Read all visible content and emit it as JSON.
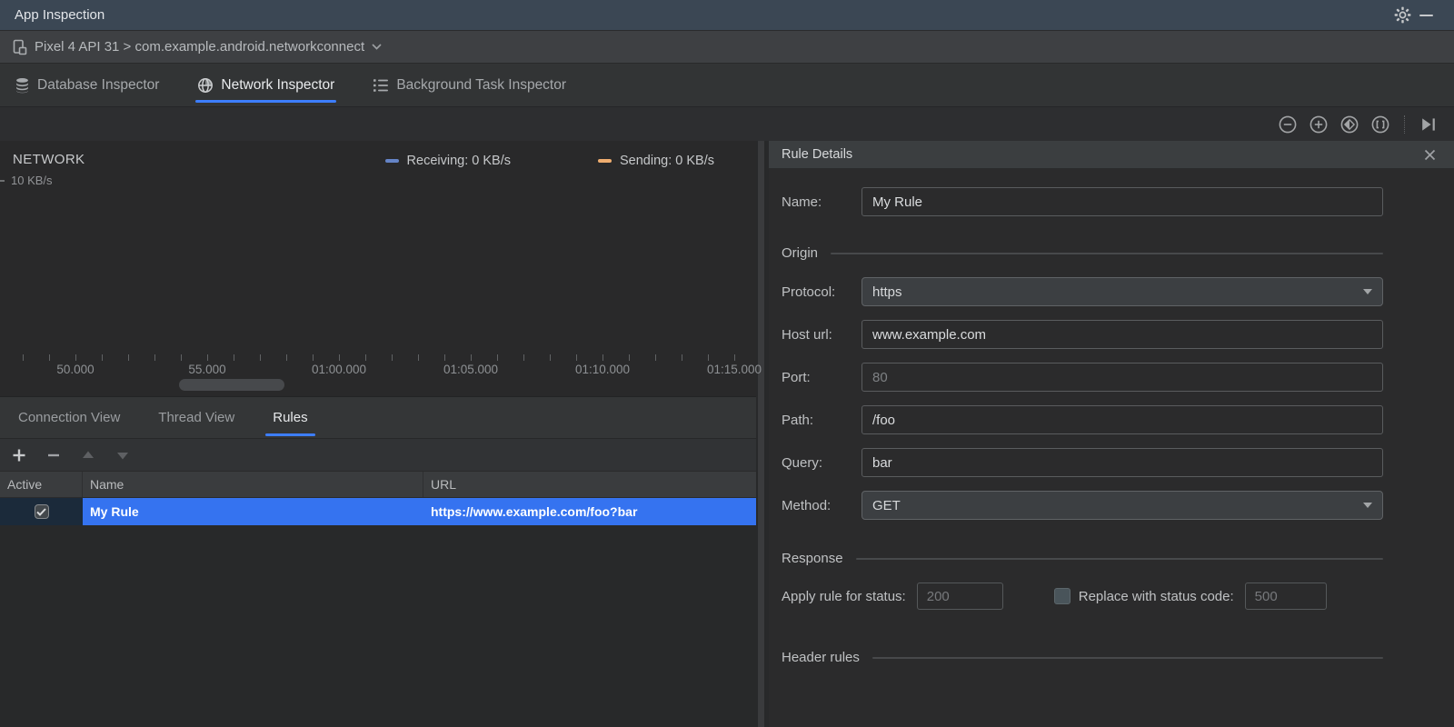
{
  "colors": {
    "accent": "#3D7EFF",
    "selection": "#3573F0",
    "receiving": "#6584C7",
    "sending": "#EFAD6F"
  },
  "window": {
    "title": "App Inspection"
  },
  "device_bar": {
    "label": "Pixel 4 API 31 > com.example.android.networkconnect"
  },
  "inspector_tabs": [
    {
      "label": "Database Inspector",
      "active": false
    },
    {
      "label": "Network Inspector",
      "active": true
    },
    {
      "label": "Background Task Inspector",
      "active": false
    }
  ],
  "chart": {
    "title": "NETWORK",
    "y_axis_label": "10 KB/s",
    "legend": [
      {
        "label": "Receiving: 0 KB/s",
        "color": "#6584C7"
      },
      {
        "label": "Sending: 0 KB/s",
        "color": "#EFAD6F"
      }
    ],
    "x_ticks": [
      "50.000",
      "55.000",
      "01:00.000",
      "01:05.000",
      "01:10.000",
      "01:15.000"
    ]
  },
  "chart_data": {
    "type": "line",
    "title": "NETWORK",
    "x": [
      "50.000",
      "55.000",
      "01:00.000",
      "01:05.000",
      "01:10.000",
      "01:15.000"
    ],
    "series": [
      {
        "name": "Receiving",
        "unit": "KB/s",
        "color": "#6584C7",
        "values": [
          0,
          0,
          0,
          0,
          0,
          0
        ]
      },
      {
        "name": "Sending",
        "unit": "KB/s",
        "color": "#EFAD6F",
        "values": [
          0,
          0,
          0,
          0,
          0,
          0
        ]
      }
    ],
    "ylim": [
      0,
      10
    ],
    "ylabel": "KB/s",
    "legend_position": "top-right",
    "grid": false
  },
  "view_tabs": [
    {
      "label": "Connection View",
      "active": false
    },
    {
      "label": "Thread View",
      "active": false
    },
    {
      "label": "Rules",
      "active": true
    }
  ],
  "rules_table": {
    "columns": [
      "Active",
      "Name",
      "URL"
    ],
    "rows": [
      {
        "active": true,
        "name": "My Rule",
        "url": "https://www.example.com/foo?bar"
      }
    ]
  },
  "rule_details": {
    "title": "Rule Details",
    "name_label": "Name:",
    "name_value": "My Rule",
    "sections": {
      "origin": "Origin",
      "response": "Response",
      "header_rules": "Header rules"
    },
    "origin": {
      "protocol_label": "Protocol:",
      "protocol_value": "https",
      "host_label": "Host url:",
      "host_value": "www.example.com",
      "port_label": "Port:",
      "port_placeholder": "80",
      "path_label": "Path:",
      "path_value": "/foo",
      "query_label": "Query:",
      "query_value": "bar",
      "method_label": "Method:",
      "method_value": "GET"
    },
    "response": {
      "status_label": "Apply rule for status:",
      "status_placeholder": "200",
      "replace_label": "Replace with status code:",
      "replace_placeholder": "500",
      "replace_checked": false
    }
  }
}
